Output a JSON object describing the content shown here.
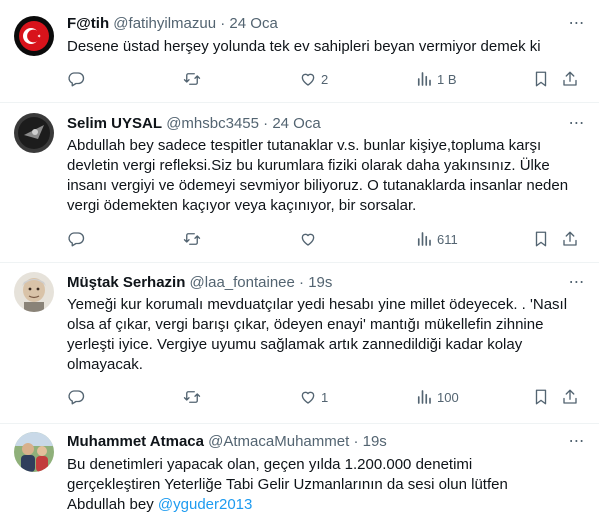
{
  "tweets": [
    {
      "name": "F@tih",
      "handle": "@fatihyilmazuu",
      "sep": "·",
      "date": "24 Oca",
      "lines": [
        "Desene üstad herşey yolunda tek ev sahipleri beyan vermiyor demek ki"
      ],
      "replies": "",
      "retweets": "",
      "likes": "2",
      "views": "1 B"
    },
    {
      "name": "Selim UYSAL",
      "handle": "@mhsbc3455",
      "sep": "·",
      "date": "24 Oca",
      "lines": [
        "Abdullah bey sadece tespitler tutanaklar v.s. bunlar kişiye,topluma karşı",
        "devletin vergi refleksi.Siz bu kurumlara fiziki olarak daha yakınsınız. Ülke",
        "insanı vergiyi ve ödemeyi sevmiyor biliyoruz. O tutanaklarda insanlar neden",
        "vergi ödemekten kaçıyor veya kaçınıyor, bir sorsalar."
      ],
      "replies": "",
      "retweets": "",
      "likes": "",
      "views": "611"
    },
    {
      "name": "Müştak Serhazin",
      "handle": "@laa_fontainee",
      "sep": "·",
      "date": "19s",
      "lines": [
        "Yemeği kur korumalı mevduatçılar yedi hesabı yine millet ödeyecek. . 'Nasıl",
        "olsa af çıkar, vergi barışı çıkar, ödeyen enayi' mantığı mükellefin zihnine",
        "yerleşti iyice. Vergiye uyumu sağlamak artık zannedildiği kadar kolay",
        "olmayacak."
      ],
      "replies": "",
      "retweets": "",
      "likes": "1",
      "views": "100"
    },
    {
      "name": "Muhammet Atmaca",
      "handle": "@AtmacaMuhammet",
      "sep": "·",
      "date": "19s",
      "lines": [
        "Bu denetimleri yapacak olan, geçen yılda 1.200.000 denetimi",
        "gerçekleştiren Yeterliğe Tabi Gelir Uzmanlarının da sesi olun lütfen"
      ],
      "last_line_text": "Abdullah bey ",
      "last_line_mention": "@yguder2013"
    }
  ],
  "colors": {
    "text": "#0f1419",
    "muted": "#536471",
    "link": "#1d9bf0",
    "divider": "#eff3f4"
  },
  "icons": [
    "more-icon",
    "reply-icon",
    "retweet-icon",
    "like-icon",
    "views-icon",
    "bookmark-icon",
    "share-icon"
  ]
}
